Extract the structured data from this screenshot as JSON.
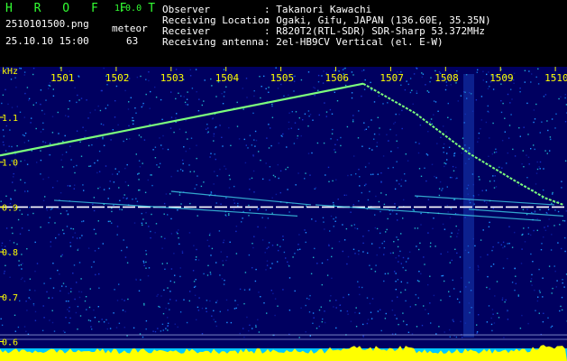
{
  "header": {
    "logo": "H R O F F T",
    "version": "1.0.0",
    "filename": "2510101500.png",
    "datetime": "25.10.10 15:00",
    "meteor_label": "meteor",
    "meteor_count": "63",
    "observer_label": "Observer",
    "observer_value": ": Takanori Kawachi",
    "location_label": "Receiving Location",
    "location_value": ": Ogaki, Gifu, JAPAN (136.60E, 35.35N)",
    "receiver_label": "Receiver",
    "receiver_value": ": R820T2(RTL-SDR) SDR-Sharp 53.372MHz",
    "antenna_label": "Receiving antenna",
    "antenna_value": ": 2el-HB9CV Vertical (el. E-W)"
  },
  "spectrogram": {
    "y_unit": "kHz",
    "time_ticks": [
      "1501",
      "1502",
      "1503",
      "1504",
      "1505",
      "1506",
      "1507",
      "1508",
      "1509",
      "1510"
    ],
    "freq_ticks": [
      "1.1",
      "1.0",
      "0.9",
      "0.8",
      "0.7",
      "0.6"
    ],
    "freq_values": [
      1.1,
      1.0,
      0.9,
      0.8,
      0.7,
      0.6
    ],
    "colors": {
      "background": "#000060",
      "tick_labels": "#ffff00",
      "carrier_line": "#ffffff",
      "trace_green": "#7cff7c",
      "noise_floor": "#ffff00",
      "noise_base": "#00c8ff"
    }
  }
}
